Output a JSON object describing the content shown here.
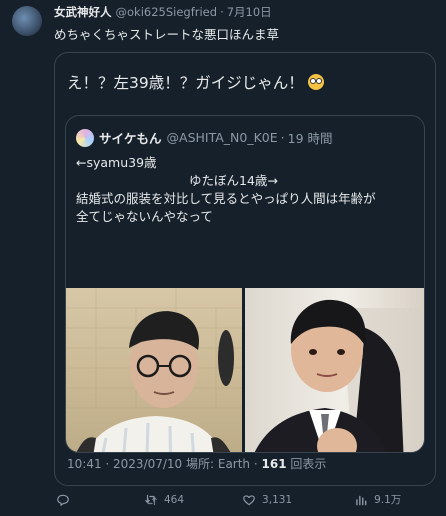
{
  "tweet": {
    "author_name": "女武神好人",
    "author_handle": "@oki625Siegfried",
    "separator": "·",
    "date": "7月10日",
    "text": "めちゃくちゃストレートな悪口ほんま草"
  },
  "quote_tweet": {
    "text": "え！？左39歳！？ガイジじゃん！",
    "quoted": {
      "author_name": "サイケもん",
      "author_handle": "@ASHITA_N0_K0E",
      "separator": "·",
      "time": "19 時間",
      "line1": "←syamu39歳",
      "line2": "ゆたぼん14歳→",
      "line3": "結婚式の服装を対比して見るとやっぱり人間は年齢が",
      "line4": "全てじゃないんやなって"
    },
    "meta": {
      "time_date": "10:41 · 2023/07/10 場所: Earth ·",
      "views_count": "161",
      "views_label": "回表示"
    }
  },
  "actions": {
    "replies": "",
    "retweets": "464",
    "likes": "3,131",
    "views": "9.1万"
  }
}
